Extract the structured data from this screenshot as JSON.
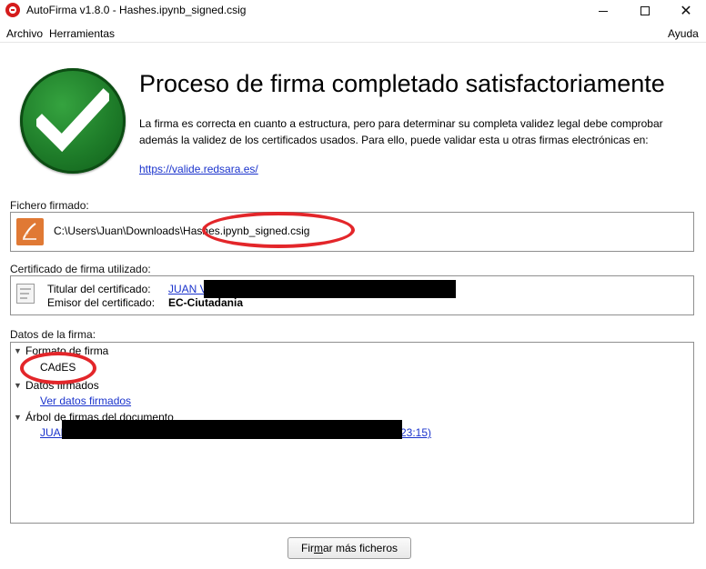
{
  "window": {
    "title": "AutoFirma v1.8.0 - Hashes.ipynb_signed.csig",
    "close_glyph": "✕"
  },
  "menu": {
    "archivo": "Archivo",
    "herramientas": "Herramientas",
    "ayuda": "Ayuda"
  },
  "result": {
    "headline": "Proceso de firma completado satisfactoriamente",
    "info_line1": "La firma es correcta en cuanto a estructura, pero para determinar su completa validez legal debe comprobar",
    "info_line2": "además la validez de los certificados usados. Para ello, puede validar esta u otras firmas electrónicas en:",
    "validation_link": "https://valide.redsara.es/"
  },
  "signed_file": {
    "section_label": "Fichero firmado:",
    "path": "C:\\Users\\Juan\\Downloads\\Hashes.ipynb_signed.csig"
  },
  "certificate": {
    "section_label": "Certificado de firma utilizado:",
    "holder_label": "Titular del certificado:",
    "holder_value": "JUAN V",
    "issuer_label": "Emisor del certificado:",
    "issuer_value": "EC-Ciutadania"
  },
  "signature_data": {
    "section_label": "Datos de la firma:",
    "format_node": "Formato de firma",
    "format_value": "CAdES",
    "signed_data_node": "Datos firmados",
    "signed_data_link": "Ver datos firmados",
    "tree_node": "Árbol de firmas del documento",
    "tree_entry_start": "JUAN",
    "tree_entry_end": "23:15)"
  },
  "actions": {
    "sign_more_pre": "Fir",
    "sign_more_mnemonic": "m",
    "sign_more_post": "ar más ficheros"
  },
  "colors": {
    "link": "#1a33cc",
    "success_green": "#1e7c29",
    "highlight_red": "#e3262a",
    "file_icon_orange": "#e07934"
  },
  "icons": {
    "app": "autofirma-logo-icon",
    "success": "checkmark-icon",
    "file": "signed-file-icon",
    "certificate": "certificate-icon"
  }
}
